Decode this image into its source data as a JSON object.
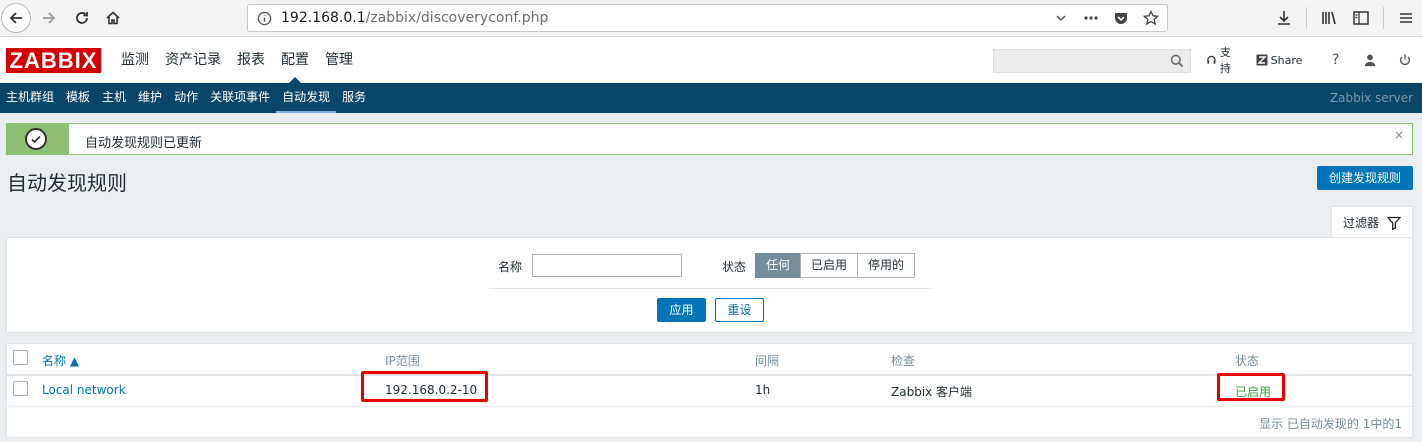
{
  "browser": {
    "url_host": "192.168.0.1",
    "url_path": "/zabbix/discoveryconf.php"
  },
  "header": {
    "logo": "ZABBIX",
    "menu": [
      "监测",
      "资产记录",
      "报表",
      "配置",
      "管理"
    ],
    "active_menu": "配置",
    "support_label": "支持",
    "share_label": "Share",
    "help_label": "?"
  },
  "submenu": {
    "items": [
      "主机群组",
      "模板",
      "主机",
      "维护",
      "动作",
      "关联项事件",
      "自动发现",
      "服务"
    ],
    "active": "自动发现",
    "server_name": "Zabbix server"
  },
  "message": {
    "text": "自动发现规则已更新",
    "close": "×"
  },
  "page": {
    "title": "自动发现规则",
    "create_button": "创建发现规则"
  },
  "filter": {
    "tab_label": "过滤器",
    "name_label": "名称",
    "name_value": "",
    "status_label": "状态",
    "status_options": [
      "任何",
      "已启用",
      "停用的"
    ],
    "status_selected": "任何",
    "apply_label": "应用",
    "reset_label": "重设"
  },
  "table": {
    "headers": {
      "name": "名称 ▲",
      "ip_range": "IP范围",
      "interval": "间隔",
      "checks": "检查",
      "status": "状态"
    },
    "rows": [
      {
        "name": "Local network",
        "ip_range": "192.168.0.2-10",
        "interval": "1h",
        "checks": "Zabbix 客户端",
        "status": "已启用"
      }
    ],
    "footer": "显示 已自动发现的 1中的1"
  },
  "colors": {
    "accent": "#0275b8",
    "nav_bg": "#0a466a",
    "success": "#8fbf74",
    "status_enabled": "#429e47",
    "highlight": "#e60000"
  }
}
